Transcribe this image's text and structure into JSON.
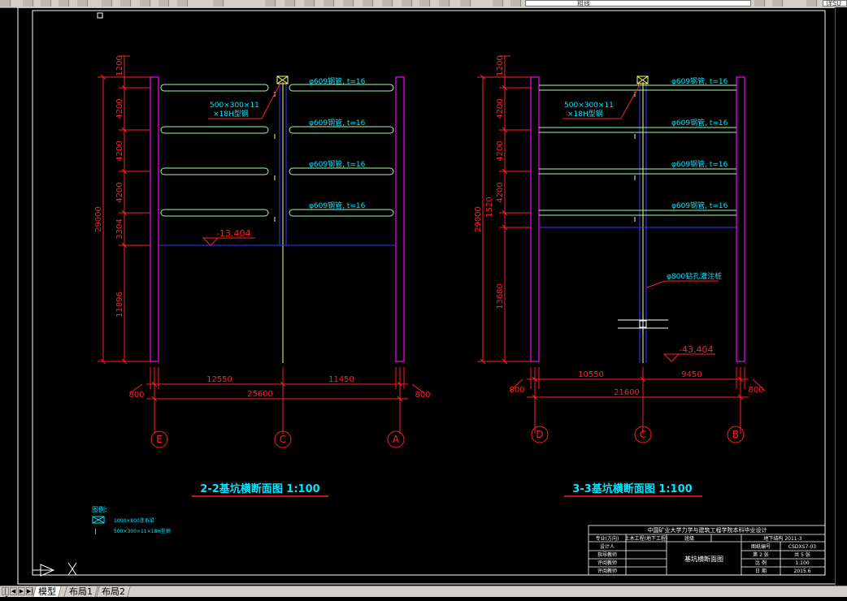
{
  "toolbar": {
    "layer_combo": "粗线",
    "right_combo": "详SU"
  },
  "tabs": [
    {
      "label": "模型",
      "active": true
    },
    {
      "label": "布局1",
      "active": false
    },
    {
      "label": "布局2",
      "active": false
    }
  ],
  "section_left": {
    "title": "2-2基坑横断面图 1:100",
    "total_height": "29000",
    "levels": [
      "1200",
      "4200",
      "4200",
      "4200",
      "3304"
    ],
    "lower_depth": "11896",
    "beam_label_1": "500×300×11",
    "beam_label_2": "×18H型钢",
    "strut_labels": [
      "φ609钢管, t=16",
      "φ609钢管, t=16",
      "φ609钢管, t=16",
      "φ609钢管, t=16"
    ],
    "elevation": "-13.404",
    "span_left": "12550",
    "span_right": "11450",
    "span_total": "25600",
    "edge_left": "800",
    "edge_right": "800",
    "axes": [
      "E",
      "C",
      "A"
    ]
  },
  "section_right": {
    "title": "3-3基坑横断面图 1:100",
    "total_height": "29000",
    "levels": [
      "1200",
      "4200",
      "4200",
      "4200",
      "1520"
    ],
    "lower_depth": "13680",
    "beam_label_1": "500×300×11",
    "beam_label_2": "×18H型钢",
    "strut_labels": [
      "φ609钢管, t=16",
      "φ609钢管, t=16",
      "φ609钢管, t=16",
      "φ609钢管, t=16"
    ],
    "pile_label": "φ800钻孔灌注桩",
    "elevation": "-43.404",
    "span_left": "10550",
    "span_right": "9450",
    "span_total": "21600",
    "edge_left": "800",
    "edge_right": "800",
    "axes": [
      "D",
      "C",
      "B"
    ]
  },
  "legend": {
    "title": "图例:",
    "item1": "1000×800连系梁",
    "item2": "500×300×11×18H型钢"
  },
  "title_block": {
    "header": "中国矿业大学力学与建筑工程学院本科毕业设计",
    "row1_a": "专业(方向)",
    "row1_b": "土木工程(地下工程)",
    "row1_c": "班级",
    "row1_d": "地下结构 2011-3",
    "r2": "设计人",
    "r3": "指导教师",
    "r4": "评阅教师",
    "r5": "评阅教师",
    "drawing_name": "基坑横断面图",
    "k1": "图纸编号",
    "v1": "CSDXS7-03",
    "k2": "第 2 张",
    "v2": "共 5 张",
    "k3": "比 例",
    "v3": "1:100",
    "k4": "日 期",
    "v4": "2015.6"
  },
  "colors": {
    "red": "#ff2020",
    "magenta": "#ff00ff",
    "green": "#9fff9f",
    "cyan": "#00e5ff",
    "blue": "#3a3aff",
    "white": "#ffffff",
    "yellow": "#ffff66"
  }
}
